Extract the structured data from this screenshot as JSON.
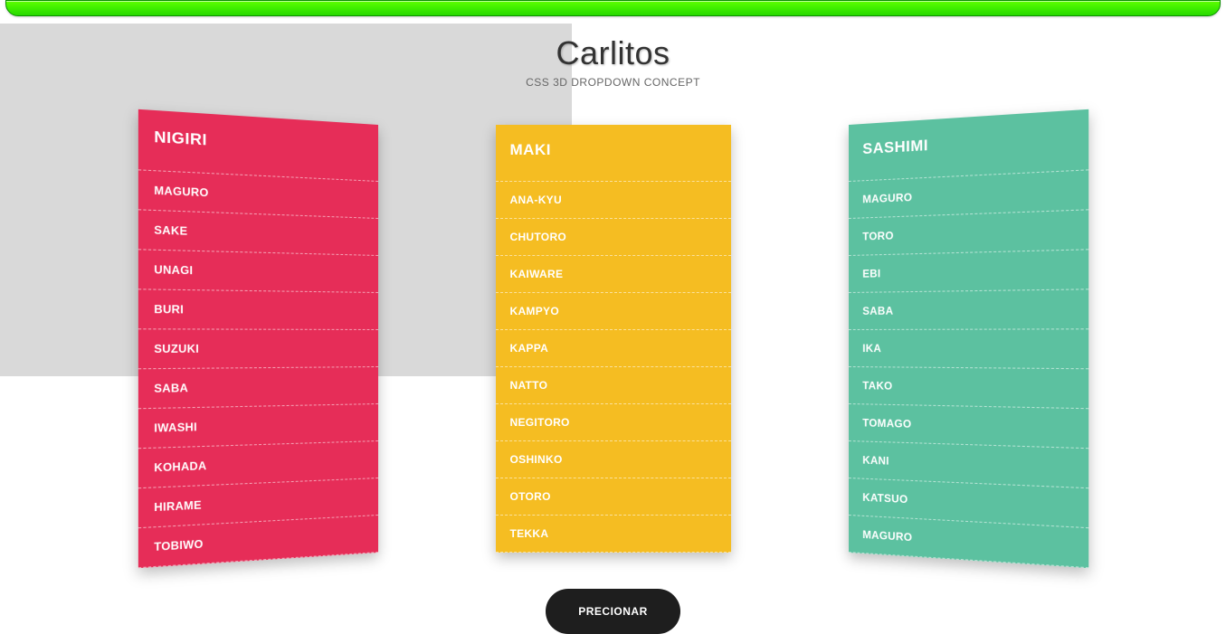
{
  "header": {
    "title": "Carlitos",
    "subtitle": "CSS 3D DROPDOWN CONCEPT"
  },
  "menus": [
    {
      "title": "NIGIRI",
      "color": "#e62d58",
      "items": [
        "MAGURO",
        "SAKE",
        "UNAGI",
        "BURI",
        "SUZUKI",
        "SABA",
        "IWASHI",
        "KOHADA",
        "HIRAME",
        "TOBIWO"
      ]
    },
    {
      "title": "MAKI",
      "color": "#f5bd22",
      "items": [
        "ANA-KYU",
        "CHUTORO",
        "KAIWARE",
        "KAMPYO",
        "KAPPA",
        "NATTO",
        "NEGITORO",
        "OSHINKO",
        "OTORO",
        "TEKKA"
      ]
    },
    {
      "title": "SASHIMI",
      "color": "#5cc1a0",
      "items": [
        "MAGURO",
        "TORO",
        "EBI",
        "SABA",
        "IKA",
        "TAKO",
        "TOMAGO",
        "KANI",
        "KATSUO",
        "MAGURO"
      ]
    }
  ],
  "button": {
    "label": "PRECIONAR"
  }
}
